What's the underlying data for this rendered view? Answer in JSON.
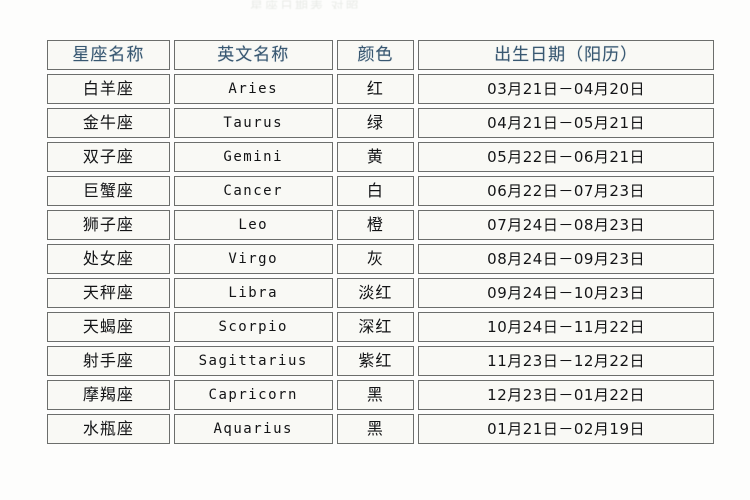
{
  "page": {
    "top_sliver_text": "星座日期表 对照"
  },
  "table": {
    "columns": [
      {
        "key": "name",
        "label": "星座名称"
      },
      {
        "key": "en",
        "label": "英文名称"
      },
      {
        "key": "color",
        "label": "颜色"
      },
      {
        "key": "date",
        "label": "出生日期（阳历）"
      }
    ],
    "rows": [
      {
        "name": "白羊座",
        "en": "Aries",
        "color": "红",
        "date": "03月21日－04月20日"
      },
      {
        "name": "金牛座",
        "en": "Taurus",
        "color": "绿",
        "date": "04月21日－05月21日"
      },
      {
        "name": "双子座",
        "en": "Gemini",
        "color": "黄",
        "date": "05月22日－06月21日"
      },
      {
        "name": "巨蟹座",
        "en": "Cancer",
        "color": "白",
        "date": "06月22日－07月23日"
      },
      {
        "name": "狮子座",
        "en": "Leo",
        "color": "橙",
        "date": "07月24日－08月23日"
      },
      {
        "name": "处女座",
        "en": "Virgo",
        "color": "灰",
        "date": "08月24日－09月23日"
      },
      {
        "name": "天秤座",
        "en": "Libra",
        "color": "淡红",
        "date": "09月24日－10月23日"
      },
      {
        "name": "天蝎座",
        "en": "Scorpio",
        "color": "深红",
        "date": "10月24日－11月22日"
      },
      {
        "name": "射手座",
        "en": "Sagittarius",
        "color": "紫红",
        "date": "11月23日－12月22日"
      },
      {
        "name": "摩羯座",
        "en": "Capricorn",
        "color": "黑",
        "date": "12月23日－01月22日"
      },
      {
        "name": "水瓶座",
        "en": "Aquarius",
        "color": "黑",
        "date": "01月21日－02月19日"
      }
    ]
  },
  "colors": {
    "header_fill": "#8ecbf5",
    "header_text": "#3c5a72",
    "cell_fill": "#f4f4f0",
    "cell_text": "#17181a",
    "border": "#6d6f6d",
    "page_background": "#fdfdfc"
  }
}
